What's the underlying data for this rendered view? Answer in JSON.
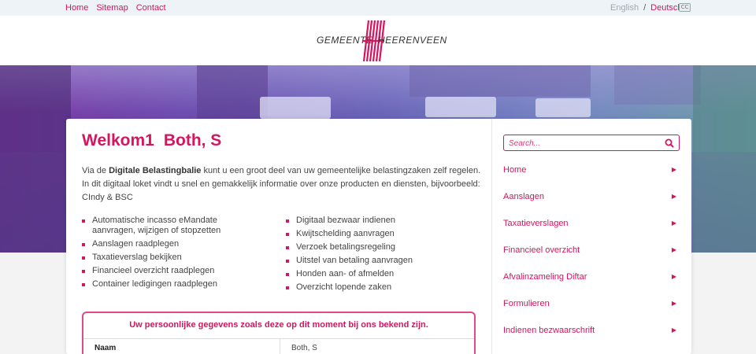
{
  "topnav": {
    "home": "Home",
    "sitemap": "Sitemap",
    "contact": "Contact"
  },
  "lang": {
    "english": "English",
    "separator": "/",
    "deutsch": "Deutsch",
    "cc": "CC"
  },
  "logo": {
    "word1": "GEMEENTE",
    "word2": "HEERENVEEN"
  },
  "main": {
    "title_part1": "Welkom1",
    "title_part2": "Both, S",
    "intro_prefix": "Via de",
    "intro_bold": "Digitale Belastingbalie",
    "intro_suffix": "kunt u een groot deel van uw gemeentelijke belastingzaken zelf regelen.",
    "intro_line2": "In dit digitaal loket vindt u snel en gemakkelijk informatie over onze producten en diensten, bijvoorbeeld:",
    "intro_line3": "CIndy & BSC",
    "list_left": [
      "Automatische incasso eMandate aanvragen, wijzigen of stopzetten",
      "Aanslagen raadplegen",
      "Taxatieverslag bekijken",
      "Financieel overzicht raadplegen",
      "Container ledigingen raadplegen"
    ],
    "list_right": [
      "Digitaal bezwaar indienen",
      "Kwijtschelding aanvragen",
      "Verzoek betalingsregeling",
      "Uitstel van betaling aanvragen",
      "Honden aan- of afmelden",
      "Overzicht lopende zaken"
    ],
    "info_heading": "Uw persoonlijke gegevens zoals deze op dit moment bij ons bekend zijn.",
    "info_rows": [
      {
        "key": "Naam",
        "value": "Both, S"
      }
    ]
  },
  "sidebar": {
    "search_placeholder": "Search...",
    "menu": [
      "Home",
      "Aanslagen",
      "Taxatieverslagen",
      "Financieel overzicht",
      "Afvalinzameling Diftar",
      "Formulieren",
      "Indienen bezwaarschrift"
    ]
  },
  "colors": {
    "accent": "#d6145f"
  },
  "icons": [
    "search-icon",
    "chevron-right-icon",
    "cc-icon"
  ]
}
